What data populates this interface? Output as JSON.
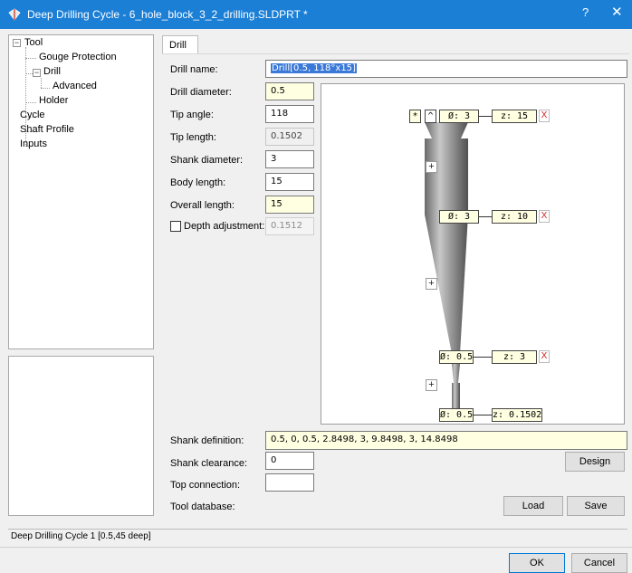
{
  "window": {
    "title": "Deep Drilling Cycle  - 6_hole_block_3_2_drilling.SLDPRT *",
    "help_label": "?",
    "close_label": "✕"
  },
  "tree": {
    "tool": "Tool",
    "gouge": "Gouge Protection",
    "drill": "Drill",
    "advanced": "Advanced",
    "holder": "Holder",
    "cycle": "Cycle",
    "shaft": "Shaft Profile",
    "inputs": "Inputs",
    "collapse_glyph": "−"
  },
  "tab": {
    "label": "Drill"
  },
  "form": {
    "drill_name": {
      "label": "Drill name:",
      "value": "Drill[0.5, 118°x15]"
    },
    "drill_diameter": {
      "label": "Drill diameter:",
      "value": "0.5"
    },
    "tip_angle": {
      "label": "Tip angle:",
      "value": "118"
    },
    "tip_length": {
      "label": "Tip length:",
      "value": "0.1502"
    },
    "shank_diameter": {
      "label": "Shank diameter:",
      "value": "3"
    },
    "body_length": {
      "label": "Body length:",
      "value": "15"
    },
    "overall_length": {
      "label": "Overall length:",
      "value": "15"
    },
    "depth_adjustment": {
      "label": "Depth adjustment:",
      "value": "0.1512",
      "checked": false
    },
    "shank_definition": {
      "label": "Shank definition:",
      "value": "0.5, 0, 0.5, 2.8498, 3, 9.8498, 3, 14.8498"
    },
    "shank_clearance": {
      "label": "Shank clearance:",
      "value": "0"
    },
    "top_connection": {
      "label": "Top connection:",
      "value": ""
    },
    "tool_database": {
      "label": "Tool database:"
    }
  },
  "diagram": {
    "star_label": "*",
    "up_label": "^",
    "plus_label": "+",
    "x_label": "X",
    "rows": [
      {
        "d": "Ø: 3",
        "z": "z: 15"
      },
      {
        "d": "Ø: 3",
        "z": "z: 10"
      },
      {
        "d": "Ø: 0.5",
        "z": "z: 3"
      },
      {
        "d": "Ø: 0.5",
        "z": "z: 0.1502"
      }
    ]
  },
  "buttons": {
    "design": "Design",
    "load": "Load",
    "save": "Save",
    "ok": "OK",
    "cancel": "Cancel"
  },
  "status": {
    "text": "Deep Drilling Cycle 1 [0.5,45 deep]"
  },
  "colors": {
    "titlebar": "#1b7fd6",
    "field_highlight": "#ffffe1",
    "selection": "#3a79d8"
  }
}
